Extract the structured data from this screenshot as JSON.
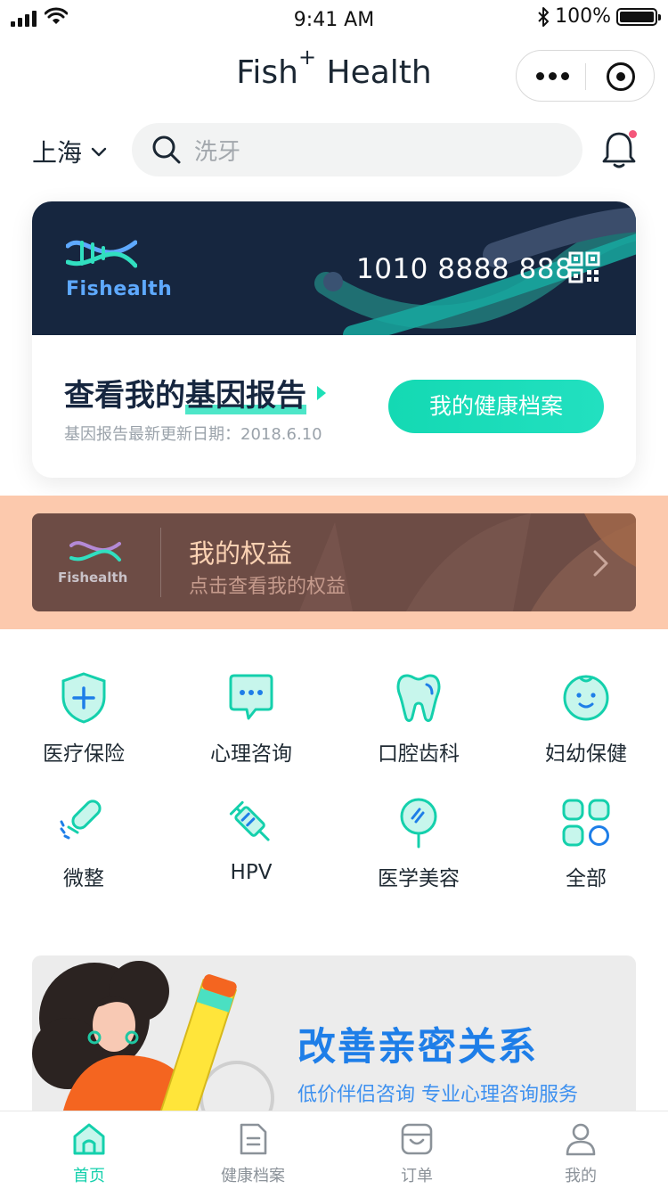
{
  "status_bar": {
    "time": "9:41 AM",
    "battery": "100%"
  },
  "nav": {
    "title": "Fish",
    "title_sup": "+",
    "title_rest": " Health"
  },
  "location": {
    "city": "上海"
  },
  "search": {
    "placeholder": "洗牙"
  },
  "member_card": {
    "logo_text": "Fishealth",
    "card_number": "1010 8888 888",
    "gene_title_prefix": "查看我的",
    "gene_title_highlight": "基因报告",
    "gene_update": "基因报告最新更新日期：2018.6.10",
    "health_button": "我的健康档案"
  },
  "benefits": {
    "logo_text": "Fishealth",
    "title": "我的权益",
    "subtitle": "点击查看我的权益"
  },
  "services": [
    {
      "label": "医疗保险",
      "icon": "shield-plus-icon"
    },
    {
      "label": "心理咨询",
      "icon": "chat-bubble-icon"
    },
    {
      "label": "口腔齿科",
      "icon": "tooth-icon"
    },
    {
      "label": "妇幼保健",
      "icon": "baby-face-icon"
    },
    {
      "label": "微整",
      "icon": "syringe-dots-icon"
    },
    {
      "label": "HPV",
      "icon": "vaccine-icon"
    },
    {
      "label": "医学美容",
      "icon": "mirror-icon"
    },
    {
      "label": "全部",
      "icon": "grid-all-icon"
    }
  ],
  "promo": {
    "title": "改善亲密关系",
    "subtitle": "低价伴侣咨询 专业心理咨询服务"
  },
  "tabs": [
    {
      "label": "首页",
      "icon": "home-icon",
      "active": true
    },
    {
      "label": "健康档案",
      "icon": "document-icon",
      "active": false
    },
    {
      "label": "订单",
      "icon": "cart-icon",
      "active": false
    },
    {
      "label": "我的",
      "icon": "user-icon",
      "active": false
    }
  ],
  "colors": {
    "accent": "#14d9b3",
    "card_dark": "#16263f",
    "benefit_band": "#fcc9ad",
    "benefit_card": "#6d4c45",
    "promo_blue": "#1e7ee8",
    "notification_dot": "#f4577a"
  }
}
